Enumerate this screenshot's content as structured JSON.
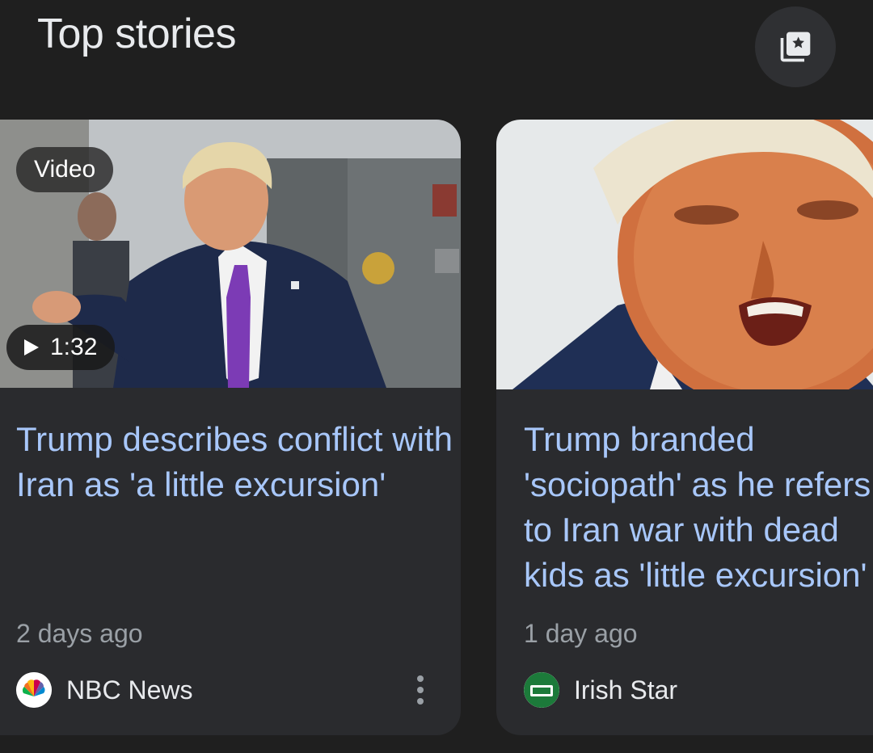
{
  "header": {
    "title": "Top stories",
    "saved_icon": "saved-collection-icon"
  },
  "stories": [
    {
      "badge": "Video",
      "duration": "1:32",
      "headline": "Trump describes conflict with Iran as 'a little excursion'",
      "time": "2 days ago",
      "source": "NBC News",
      "source_icon": "nbc-peacock-logo"
    },
    {
      "headline_lines": [
        "Trump branded",
        "'sociopath' as he refers",
        "to Iran war with dead",
        "kids as 'little excursion'"
      ],
      "time": "1 day ago",
      "source": "Irish Star",
      "source_icon": "irish-star-logo"
    }
  ],
  "colors": {
    "background": "#1f1f1f",
    "card": "#2a2b2e",
    "headline": "#a8c7fa",
    "meta": "#9aa0a6"
  }
}
